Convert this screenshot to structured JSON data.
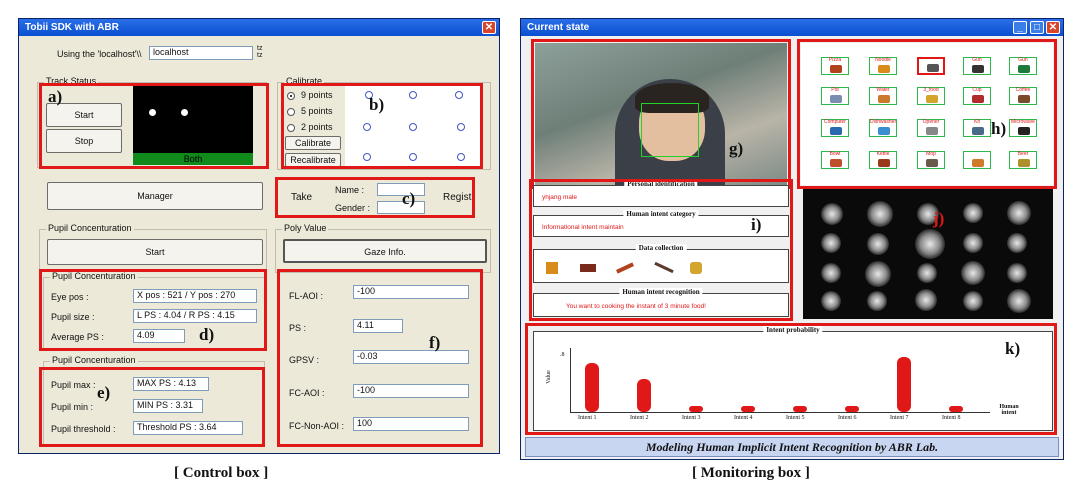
{
  "control": {
    "title": "Tobii SDK with ABR",
    "host_label": "Using the 'localhost'\\\\",
    "host_value": "localhost",
    "track_status": {
      "title": "Track Status",
      "start": "Start",
      "stop": "Stop",
      "status_bar": "Both"
    },
    "calibrate": {
      "title": "Calibrate",
      "options": [
        "9 points",
        "5 points",
        "2 points"
      ],
      "selected": "9 points",
      "calibrate_btn": "Calibrate",
      "recalibrate_btn": "Recalibrate"
    },
    "manager_btn": "Manager",
    "take": {
      "take_label": "Take",
      "name_label": "Name :",
      "gender_label": "Gender :",
      "regist_btn": "Regist"
    },
    "pupil_group": {
      "title": "Pupil Concenturation",
      "start": "Start"
    },
    "poly": {
      "title": "Poly Value",
      "gaze_btn": "Gaze Info.",
      "fields": [
        {
          "label": "FL-AOI :",
          "value": "-100"
        },
        {
          "label": "PS :",
          "value": "4.11"
        },
        {
          "label": "GPSV :",
          "value": "-0.03"
        },
        {
          "label": "FC-AOI :",
          "value": "-100"
        },
        {
          "label": "FC-Non-AOI :",
          "value": "100"
        }
      ]
    },
    "pupil_d": {
      "title": "Pupil Concenturation",
      "rows": [
        {
          "label": "Eye pos :",
          "value": "X pos : 521 / Y pos : 270"
        },
        {
          "label": "Pupil size :",
          "value": "L PS : 4.04 / R PS : 4.15"
        },
        {
          "label": "Average PS :",
          "value": "4.09"
        }
      ]
    },
    "pupil_e": {
      "title": "Pupil Concenturation",
      "rows": [
        {
          "label": "Pupil max :",
          "value": "MAX PS : 4.13"
        },
        {
          "label": "Pupil min :",
          "value": "MIN PS : 3.31"
        },
        {
          "label": "Pupil threshold :",
          "value": "Threshold PS : 3.64"
        }
      ]
    },
    "markers": {
      "a": "a)",
      "b": "b)",
      "c": "c)",
      "d": "d)",
      "e": "e)",
      "f": "f)"
    },
    "caption": "[ Control box ]"
  },
  "monitor": {
    "title": "Current state",
    "markers": {
      "g": "g)",
      "h": "h)",
      "i": "i)",
      "j": "j)",
      "k": "k)"
    },
    "personal": {
      "title": "Personal identification",
      "value": "yhjang  male"
    },
    "intent_cat": {
      "title": "Human intent category",
      "value": "Informational intent maintain"
    },
    "data_collection": {
      "title": "Data collection"
    },
    "recognition": {
      "title": "Human intent recognition",
      "value": "You want to cooking the instant of 3 minute food!"
    },
    "food_items": [
      "Pizza",
      "Noodle",
      "",
      "Gun",
      "Gun",
      "Pot",
      "Water",
      "3_food",
      "Cup",
      "Coffee",
      "Computer",
      "Dishwasher",
      "Opener",
      "Kit",
      "Microwave",
      "Bowl",
      "Kettle",
      "Mop",
      "",
      "Beer"
    ],
    "footer": "Modeling Human Implicit Intent Recognition by ABR Lab.",
    "caption": "[ Monitoring box ]"
  },
  "chart_data": {
    "type": "bar",
    "title": "Intent probability",
    "ylabel": "Value",
    "xlabel": "Human intent",
    "categories": [
      "Intent 1",
      "Intent 2",
      "Intent 3",
      "Intent 4",
      "Intent 5",
      "Intent 6",
      "Intent 7",
      "Intent 8"
    ],
    "values": [
      0.82,
      0.55,
      0.1,
      0.1,
      0.1,
      0.1,
      0.92,
      0.1
    ],
    "ylim": [
      0,
      1
    ],
    "ytick_label": ".8",
    "color": "#e01818"
  }
}
